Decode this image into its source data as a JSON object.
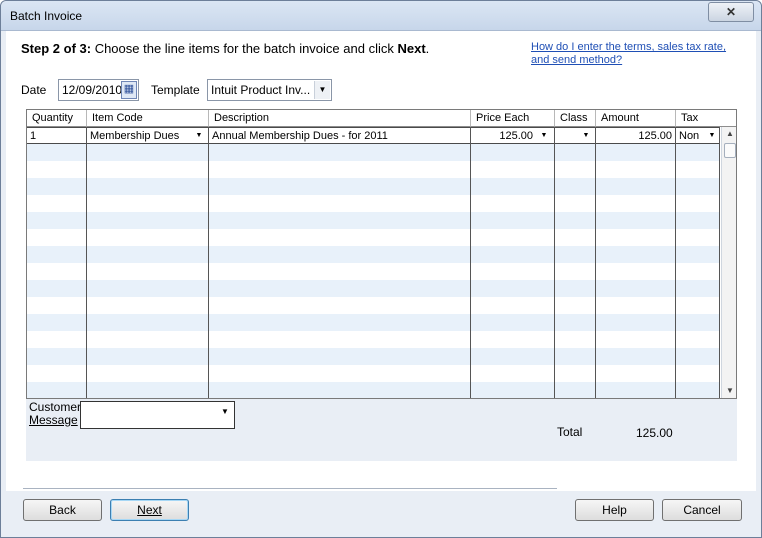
{
  "window": {
    "title": "Batch Invoice",
    "close_glyph": "✕"
  },
  "header": {
    "step_bold": "Step 2 of 3:",
    "instruction": " Choose the line items for the batch invoice and click ",
    "next_bold": "Next",
    "period": ".",
    "help_link": "How do I enter the terms, sales tax rate, and send method?"
  },
  "form": {
    "date_label": "Date",
    "date_value": "12/09/2010",
    "template_label": "Template",
    "template_value": "Intuit Product Inv..."
  },
  "grid": {
    "columns": [
      "Quantity",
      "Item Code",
      "Description",
      "Price Each",
      "Class",
      "Amount",
      "Tax"
    ],
    "rows": [
      {
        "quantity": "1",
        "item_code": "Membership Dues",
        "description": "Annual Membership Dues - for 2011",
        "price_each": "125.00",
        "class": "",
        "amount": "125.00",
        "tax": "Non"
      }
    ]
  },
  "footer": {
    "customer_label_line1": "Customer",
    "customer_label_line2": "Message",
    "customer_message_value": "",
    "total_label": "Total",
    "total_value": "125.00"
  },
  "buttons": {
    "back": "Back",
    "next": "Next",
    "help": "Help",
    "cancel": "Cancel"
  },
  "icons": {
    "calendar": "calendar-icon",
    "dropdown": "chevron-down-icon",
    "close": "close-icon"
  }
}
